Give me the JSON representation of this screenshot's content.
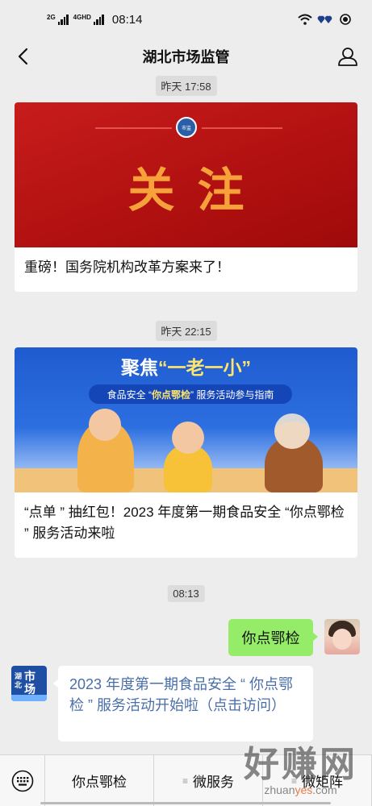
{
  "status_bar": {
    "signal1_label": "2G",
    "signal2_label": "4GHD",
    "time": "08:14"
  },
  "nav": {
    "title": "湖北市场监管"
  },
  "messages": {
    "ts1": "昨天 17:58",
    "card1": {
      "banner_text": "关注",
      "title": "重磅！国务院机构改革方案来了！"
    },
    "ts2": "昨天 22:15",
    "card2": {
      "banner_head_a": "聚焦",
      "banner_head_b": "“一老一小”",
      "banner_pill_a": "食品安全 “",
      "banner_pill_b": "你点鄂检",
      "banner_pill_c": "” 服务活动参与指南",
      "title": "“点单 ” 抽红包！2023 年度第一期食品安全 “你点鄂检 ” 服务活动来啦"
    },
    "ts3": "08:13",
    "sent_text": "你点鄂检",
    "reply_text": "2023 年度第一期食品安全 “ 你点鄂检 ” 服务活动开始啦（点击访问）"
  },
  "avatar_left": {
    "vertical_text": "湖北",
    "main_text": "市场监管"
  },
  "menu": {
    "items": [
      "你点鄂检",
      "微服务",
      "微矩阵"
    ]
  },
  "watermark": {
    "big": "好赚网",
    "small_a": "zhuan",
    "small_b": "yes",
    "small_c": ".com"
  },
  "colors": {
    "chat_bg": "#ededed",
    "sent_bubble": "#95ec69",
    "link_text": "#4a6fa8",
    "banner_red": "#c81c1c",
    "banner_orange": "#f7a13a",
    "banner_blue": "#1f5bd0"
  },
  "icons": [
    "back-chevron-icon",
    "user-profile-icon",
    "wifi-icon",
    "battery-icon",
    "keyboard-icon"
  ]
}
